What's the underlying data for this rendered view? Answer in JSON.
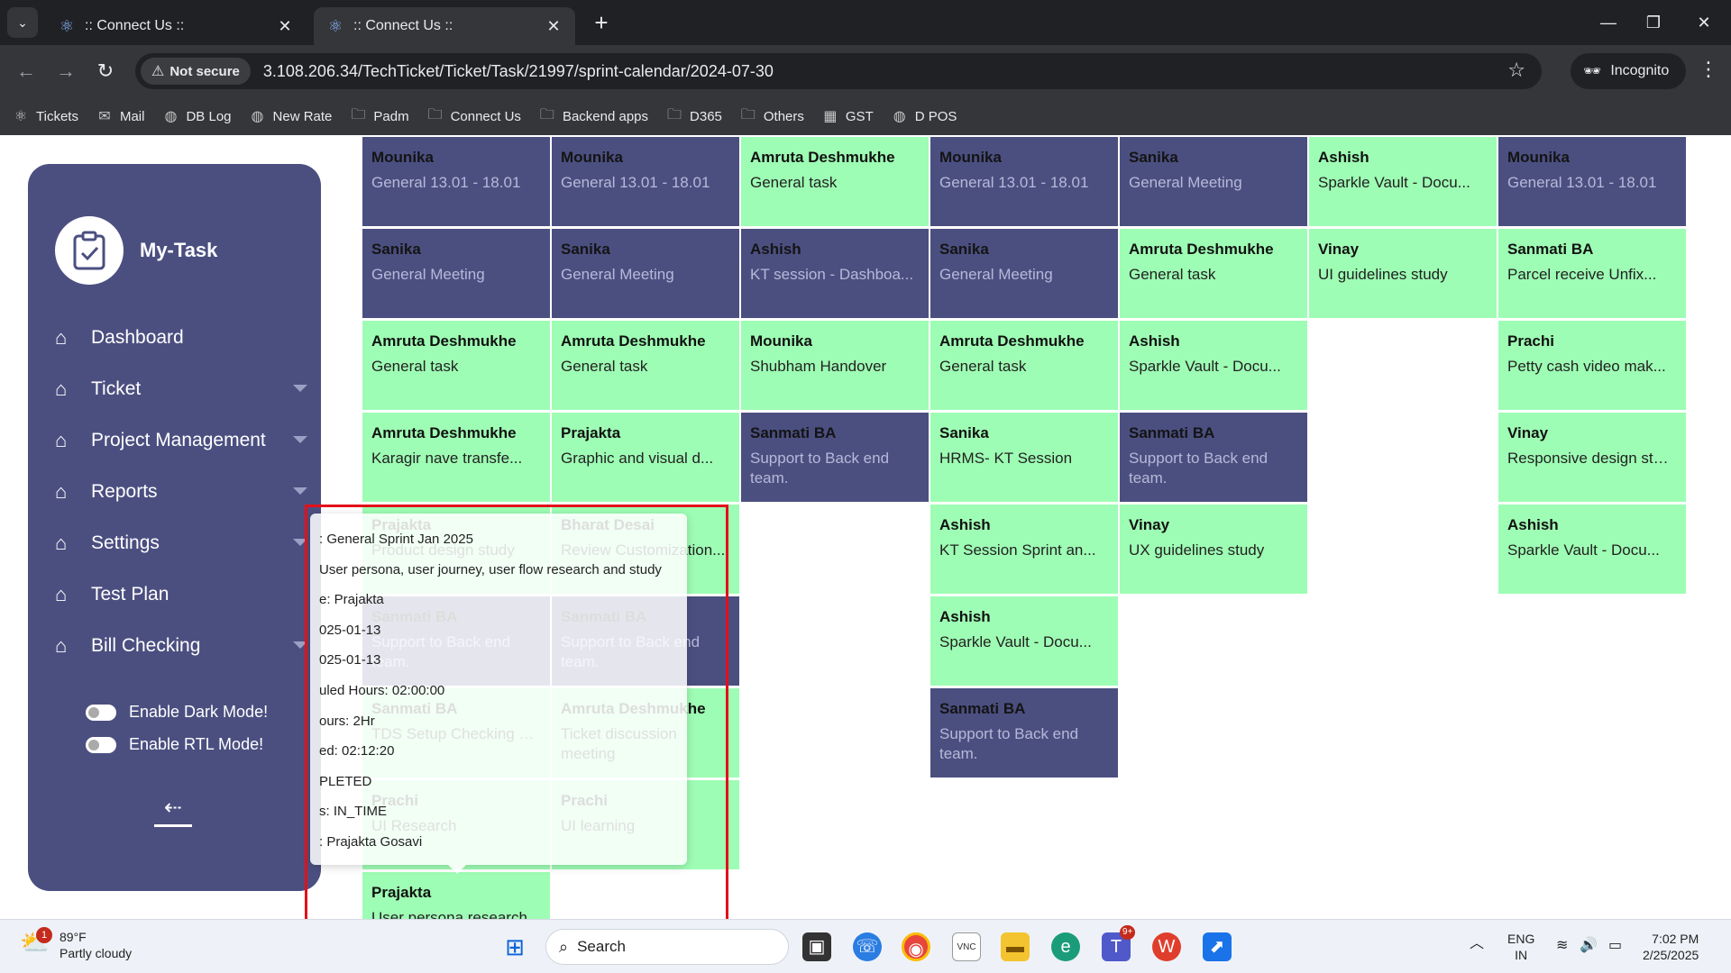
{
  "browser": {
    "tabs": [
      {
        "title": ":: Connect Us ::",
        "active": false
      },
      {
        "title": ":: Connect Us ::",
        "active": true
      }
    ],
    "security_label": "Not secure",
    "url": "3.108.206.34/TechTicket/Ticket/Task/21997/sprint-calendar/2024-07-30",
    "profile_label": "Incognito",
    "bookmarks": [
      {
        "label": "Tickets",
        "icon": "react-icon"
      },
      {
        "label": "Mail",
        "icon": "outlook-icon"
      },
      {
        "label": "DB Log",
        "icon": "globe-icon"
      },
      {
        "label": "New Rate",
        "icon": "globe-icon"
      },
      {
        "label": "Padm",
        "icon": "folder-icon"
      },
      {
        "label": "Connect Us",
        "icon": "folder-icon"
      },
      {
        "label": "Backend apps",
        "icon": "folder-icon"
      },
      {
        "label": "D365",
        "icon": "folder-icon"
      },
      {
        "label": "Others",
        "icon": "folder-icon"
      },
      {
        "label": "GST",
        "icon": "gst-icon"
      },
      {
        "label": "D POS",
        "icon": "globe-icon"
      }
    ]
  },
  "sidebar": {
    "brand": "My-Task",
    "items": [
      {
        "label": "Dashboard",
        "has_caret": false
      },
      {
        "label": "Ticket",
        "has_caret": true
      },
      {
        "label": "Project Management",
        "has_caret": true
      },
      {
        "label": "Reports",
        "has_caret": true
      },
      {
        "label": "Settings",
        "has_caret": true
      },
      {
        "label": "Test Plan",
        "has_caret": false
      },
      {
        "label": "Bill Checking",
        "has_caret": true
      }
    ],
    "dark_mode_label": "Enable Dark Mode!",
    "rtl_mode_label": "Enable RTL Mode!"
  },
  "colors": {
    "sidebar_bg": "#4b4f80",
    "task_blue": "#4b4f80",
    "task_green": "#9efdb4",
    "highlight": "#e3101a"
  },
  "calendar": {
    "columns": [
      [
        {
          "name": "Mounika",
          "task": "General 13.01 - 18.01",
          "color": "blue"
        },
        {
          "name": "Sanika",
          "task": "General Meeting",
          "color": "blue"
        },
        {
          "name": "Amruta Deshmukhe",
          "task": "General task",
          "color": "green"
        },
        {
          "name": "Amruta Deshmukhe",
          "task": "Karagir nave transfe...",
          "color": "green"
        },
        {
          "name": "Prajakta",
          "task": "Product design study",
          "color": "green"
        },
        {
          "name": "Sanmati BA",
          "task": "Support to Back end team.",
          "color": "blue"
        },
        {
          "name": "Sanmati BA",
          "task": "TDS Setup Checking W...",
          "color": "green"
        },
        {
          "name": "Prachi",
          "task": "UI Research",
          "color": "green"
        },
        {
          "name": "Prajakta",
          "task": "User persona research",
          "color": "green"
        }
      ],
      [
        {
          "name": "Mounika",
          "task": "General 13.01 - 18.01",
          "color": "blue"
        },
        {
          "name": "Sanika",
          "task": "General Meeting",
          "color": "blue"
        },
        {
          "name": "Amruta Deshmukhe",
          "task": "General task",
          "color": "green"
        },
        {
          "name": "Prajakta",
          "task": "Graphic and visual d...",
          "color": "green"
        },
        {
          "name": "Bharat Desai",
          "task": "Review Customization...",
          "color": "green"
        },
        {
          "name": "Sanmati BA",
          "task": "Support to Back end team.",
          "color": "blue"
        },
        {
          "name": "Amruta Deshmukhe",
          "task": "Ticket discussion meeting",
          "color": "green"
        },
        {
          "name": "Prachi",
          "task": "UI learning",
          "color": "green"
        }
      ],
      [
        {
          "name": "Amruta Deshmukhe",
          "task": "General task",
          "color": "green"
        },
        {
          "name": "Ashish",
          "task": "KT session - Dashboa...",
          "color": "blue"
        },
        {
          "name": "Mounika",
          "task": "Shubham Handover",
          "color": "green"
        },
        {
          "name": "Sanmati BA",
          "task": "Support to Back end team.",
          "color": "blue"
        }
      ],
      [
        {
          "name": "Mounika",
          "task": "General 13.01 - 18.01",
          "color": "blue"
        },
        {
          "name": "Sanika",
          "task": "General Meeting",
          "color": "blue"
        },
        {
          "name": "Amruta Deshmukhe",
          "task": "General task",
          "color": "green"
        },
        {
          "name": "Sanika",
          "task": "HRMS- KT Session",
          "color": "green"
        },
        {
          "name": "Ashish",
          "task": "KT Session Sprint an...",
          "color": "green"
        },
        {
          "name": "Ashish",
          "task": "Sparkle Vault - Docu...",
          "color": "green"
        },
        {
          "name": "Sanmati BA",
          "task": "Support to Back end team.",
          "color": "blue"
        }
      ],
      [
        {
          "name": "Sanika",
          "task": "General Meeting",
          "color": "blue"
        },
        {
          "name": "Amruta Deshmukhe",
          "task": "General task",
          "color": "green"
        },
        {
          "name": "Ashish",
          "task": "Sparkle Vault - Docu...",
          "color": "green"
        },
        {
          "name": "Sanmati BA",
          "task": "Support to Back end team.",
          "color": "blue"
        },
        {
          "name": "Vinay",
          "task": "UX guidelines study",
          "color": "green"
        }
      ],
      [
        {
          "name": "Ashish",
          "task": "Sparkle Vault - Docu...",
          "color": "green"
        },
        {
          "name": "Vinay",
          "task": "UI guidelines study",
          "color": "green"
        }
      ],
      [
        {
          "name": "Mounika",
          "task": "General 13.01 - 18.01",
          "color": "blue"
        },
        {
          "name": "Sanmati BA",
          "task": "Parcel receive Unfix...",
          "color": "green"
        },
        {
          "name": "Prachi",
          "task": "Petty cash video mak...",
          "color": "green"
        },
        {
          "name": "Vinay",
          "task": "Responsive design study",
          "color": "green"
        },
        {
          "name": "Ashish",
          "task": "Sparkle Vault - Docu...",
          "color": "green"
        }
      ]
    ]
  },
  "tooltip": {
    "lines": [
      ": General Sprint Jan 2025",
      "User persona, user journey, user flow research and study",
      "e: Prajakta",
      "025-01-13",
      "025-01-13",
      "uled Hours: 02:00:00",
      "ours: 2Hr",
      "ed: 02:12:20",
      "PLETED",
      "s: IN_TIME",
      ": Prajakta Gosavi"
    ]
  },
  "taskbar": {
    "weather_temp": "89°F",
    "weather_desc": "Partly cloudy",
    "weather_badge": "1",
    "search_label": "Search",
    "teams_badge": "9+",
    "lang_top": "ENG",
    "lang_bottom": "IN",
    "time": "7:02 PM",
    "date": "2/25/2025"
  }
}
